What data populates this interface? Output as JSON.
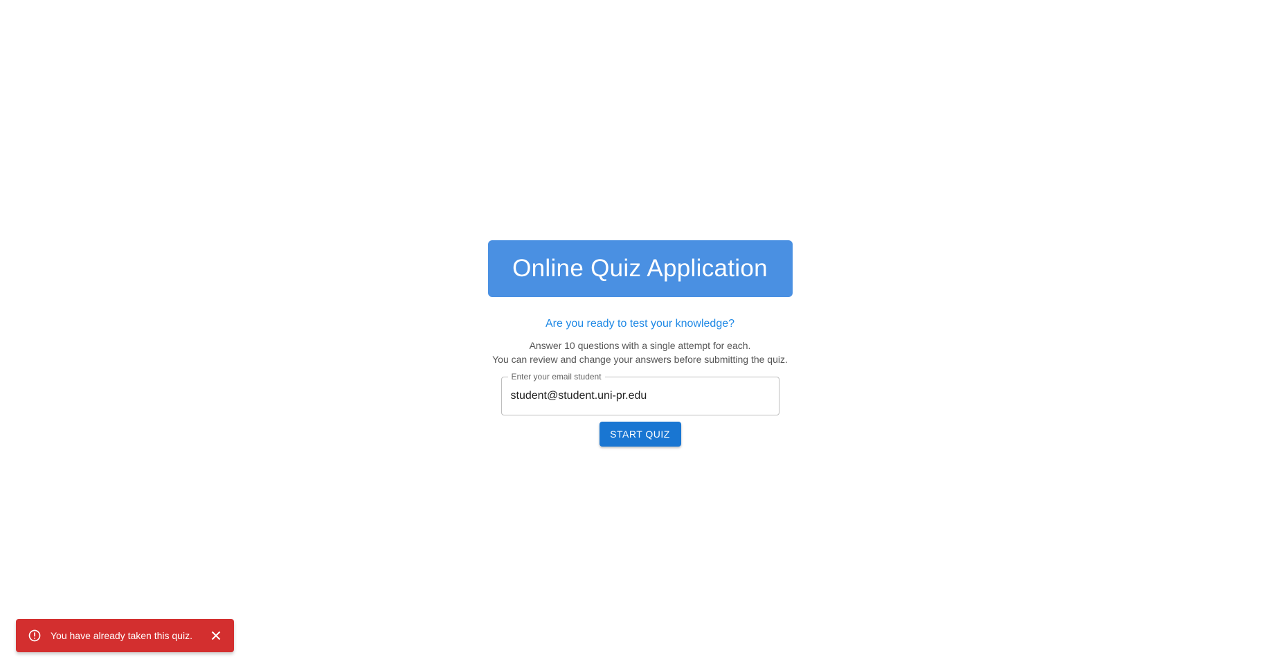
{
  "header": {
    "title": "Online Quiz Application"
  },
  "intro": {
    "tagline": "Are you ready to test your knowledge?",
    "line1": "Answer 10 questions with a single attempt for each.",
    "line2": "You can review and change your answers before submitting the quiz."
  },
  "email": {
    "label": "Enter your email student",
    "value": "student@student.uni-pr.edu"
  },
  "actions": {
    "start_label": "START QUIZ"
  },
  "snackbar": {
    "message": "You have already taken this quiz.",
    "icon": "error-outline-icon",
    "close_icon": "close-icon",
    "color": "#d32f2f"
  },
  "colors": {
    "banner": "#4a90e2",
    "accent": "#1e88e5",
    "button": "#1976d2"
  }
}
